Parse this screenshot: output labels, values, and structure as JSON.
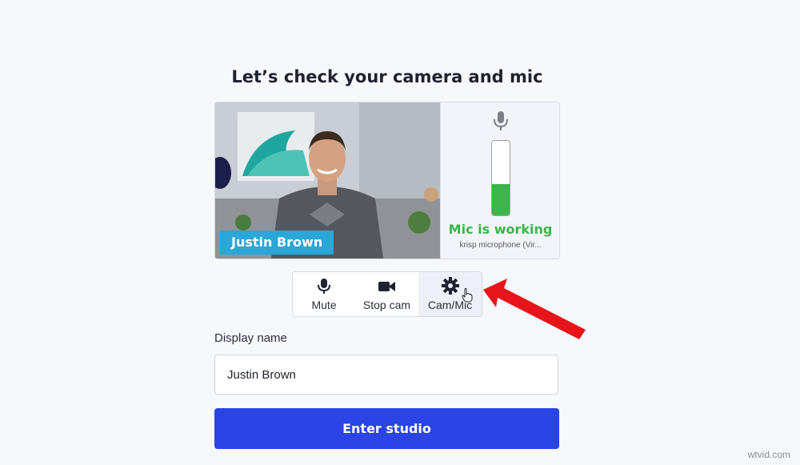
{
  "heading": "Let’s check your camera and mic",
  "video": {
    "participant_name": "Justin Brown"
  },
  "mic": {
    "icon": "microphone-icon",
    "level_fraction": 0.42,
    "level_color": "#3cb54a",
    "status": "Mic is working",
    "device": "krisp microphone (Vir..."
  },
  "controls": {
    "mute": {
      "label": "Mute",
      "icon": "microphone-icon"
    },
    "stop_cam": {
      "label": "Stop cam",
      "icon": "video-camera-icon"
    },
    "cam_mic": {
      "label": "Cam/Mic",
      "icon": "gear-icon"
    }
  },
  "display_name": {
    "label": "Display name",
    "value": "Justin Brown"
  },
  "enter_button": {
    "label": "Enter studio",
    "color": "#2a44e6"
  },
  "watermark": "wtvid.com"
}
